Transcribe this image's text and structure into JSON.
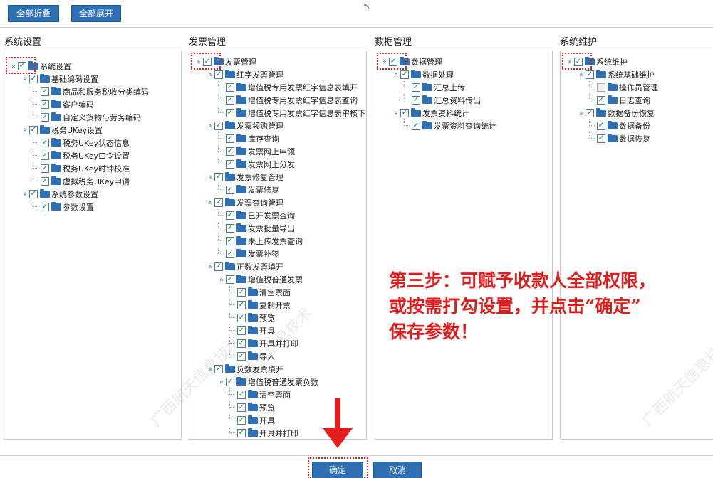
{
  "toolbar": {
    "collapse_all_label": "全部折叠",
    "expand_all_label": "全部展开"
  },
  "columns": [
    {
      "title": "系统设置",
      "nodes": [
        {
          "label": "系统设置",
          "level": 0,
          "toggle": "expanded",
          "check": "checked"
        },
        {
          "label": "基础编码设置",
          "level": 1,
          "toggle": "expanded",
          "check": "checked"
        },
        {
          "label": "商品和服务税收分类编码",
          "level": 2,
          "toggle": "leaf",
          "check": "checked"
        },
        {
          "label": "客户编码",
          "level": 2,
          "toggle": "leaf",
          "check": "checked"
        },
        {
          "label": "自定义货物与劳务编码",
          "level": 2,
          "toggle": "leaf",
          "check": "checked"
        },
        {
          "label": "税务UKey设置",
          "level": 1,
          "toggle": "expanded",
          "check": "checked"
        },
        {
          "label": "税务UKey状态信息",
          "level": 2,
          "toggle": "leaf",
          "check": "checked"
        },
        {
          "label": "税务UKey口令设置",
          "level": 2,
          "toggle": "leaf",
          "check": "checked"
        },
        {
          "label": "税务UKey时钟校准",
          "level": 2,
          "toggle": "leaf",
          "check": "checked"
        },
        {
          "label": "虚拟税务UKey申请",
          "level": 2,
          "toggle": "leaf",
          "check": "checked"
        },
        {
          "label": "系统参数设置",
          "level": 1,
          "toggle": "expanded",
          "check": "checked"
        },
        {
          "label": "参数设置",
          "level": 2,
          "toggle": "leaf",
          "check": "checked"
        }
      ]
    },
    {
      "title": "发票管理",
      "nodes": [
        {
          "label": "发票管理",
          "level": 0,
          "toggle": "expanded",
          "check": "checked"
        },
        {
          "label": "红字发票管理",
          "level": 1,
          "toggle": "expanded",
          "check": "checked"
        },
        {
          "label": "增值税专用发票红字信息表填开",
          "level": 2,
          "toggle": "leaf",
          "check": "checked"
        },
        {
          "label": "增值税专用发票红字信息表查询",
          "level": 2,
          "toggle": "leaf",
          "check": "checked"
        },
        {
          "label": "增值税专用发票红字信息表审核下载",
          "level": 2,
          "toggle": "leaf",
          "check": "checked"
        },
        {
          "label": "发票领购管理",
          "level": 1,
          "toggle": "expanded",
          "check": "checked"
        },
        {
          "label": "库存查询",
          "level": 2,
          "toggle": "leaf",
          "check": "checked"
        },
        {
          "label": "发票网上申领",
          "level": 2,
          "toggle": "leaf",
          "check": "checked"
        },
        {
          "label": "发票网上分发",
          "level": 2,
          "toggle": "leaf",
          "check": "checked"
        },
        {
          "label": "发票修复管理",
          "level": 1,
          "toggle": "expanded",
          "check": "checked"
        },
        {
          "label": "发票修复",
          "level": 2,
          "toggle": "leaf",
          "check": "checked"
        },
        {
          "label": "发票查询管理",
          "level": 1,
          "toggle": "expanded",
          "check": "checked"
        },
        {
          "label": "已开发票查询",
          "level": 2,
          "toggle": "leaf",
          "check": "checked"
        },
        {
          "label": "发票批量导出",
          "level": 2,
          "toggle": "leaf",
          "check": "checked"
        },
        {
          "label": "未上传发票查询",
          "level": 2,
          "toggle": "leaf",
          "check": "checked"
        },
        {
          "label": "发票补签",
          "level": 2,
          "toggle": "leaf",
          "check": "checked"
        },
        {
          "label": "正数发票填开",
          "level": 1,
          "toggle": "expanded",
          "check": "checked"
        },
        {
          "label": "增值税普通发票",
          "level": 2,
          "toggle": "expanded",
          "check": "checked"
        },
        {
          "label": "清空票面",
          "level": 3,
          "toggle": "leaf",
          "check": "checked"
        },
        {
          "label": "复制开票",
          "level": 3,
          "toggle": "leaf",
          "check": "checked"
        },
        {
          "label": "预览",
          "level": 3,
          "toggle": "leaf",
          "check": "checked"
        },
        {
          "label": "开具",
          "level": 3,
          "toggle": "leaf",
          "check": "checked"
        },
        {
          "label": "开具并打印",
          "level": 3,
          "toggle": "leaf",
          "check": "checked"
        },
        {
          "label": "导入",
          "level": 3,
          "toggle": "leaf",
          "check": "checked"
        },
        {
          "label": "负数发票填开",
          "level": 1,
          "toggle": "expanded",
          "check": "checked"
        },
        {
          "label": "增值税普通发票负数",
          "level": 2,
          "toggle": "expanded",
          "check": "checked"
        },
        {
          "label": "清空票面",
          "level": 3,
          "toggle": "leaf",
          "check": "checked"
        },
        {
          "label": "预览",
          "level": 3,
          "toggle": "leaf",
          "check": "checked"
        },
        {
          "label": "开具",
          "level": 3,
          "toggle": "leaf",
          "check": "checked"
        },
        {
          "label": "开具并打印",
          "level": 3,
          "toggle": "leaf",
          "check": "checked"
        }
      ]
    },
    {
      "title": "数据管理",
      "nodes": [
        {
          "label": "数据管理",
          "level": 0,
          "toggle": "expanded",
          "check": "checked"
        },
        {
          "label": "数据处理",
          "level": 1,
          "toggle": "expanded",
          "check": "checked"
        },
        {
          "label": "汇总上传",
          "level": 2,
          "toggle": "leaf",
          "check": "checked"
        },
        {
          "label": "汇总资料传出",
          "level": 2,
          "toggle": "leaf",
          "check": "checked"
        },
        {
          "label": "发票资料统计",
          "level": 1,
          "toggle": "expanded",
          "check": "checked"
        },
        {
          "label": "发票资料查询统计",
          "level": 2,
          "toggle": "leaf",
          "check": "checked"
        }
      ]
    },
    {
      "title": "系统维护",
      "nodes": [
        {
          "label": "系统维护",
          "level": 0,
          "toggle": "expanded",
          "check": "checked"
        },
        {
          "label": "系统基础维护",
          "level": 1,
          "toggle": "expanded",
          "check": "checked"
        },
        {
          "label": "操作员管理",
          "level": 2,
          "toggle": "leaf",
          "check": "partial"
        },
        {
          "label": "日志查询",
          "level": 2,
          "toggle": "leaf",
          "check": "checked"
        },
        {
          "label": "数据备份恢复",
          "level": 1,
          "toggle": "expanded",
          "check": "checked"
        },
        {
          "label": "数据备份",
          "level": 2,
          "toggle": "leaf",
          "check": "checked"
        },
        {
          "label": "数据恢复",
          "level": 2,
          "toggle": "leaf",
          "check": "checked"
        }
      ]
    }
  ],
  "annotation": {
    "line1": "第三步：可赋予收款人全部权限，",
    "line2": "或按需打勾设置，并点击“确定”",
    "line3": "保存参数！"
  },
  "watermark": "广西航天信息技术",
  "footer": {
    "confirm_label": "确定",
    "cancel_label": "取消"
  },
  "colors": {
    "primary": "#2f6fb3",
    "annotation_red": "#e41c1c",
    "check_green": "#1b7e2a"
  }
}
